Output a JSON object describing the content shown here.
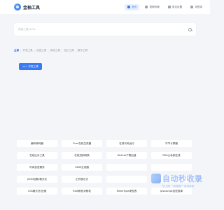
{
  "header": {
    "logo_text": "金柚工具",
    "nav": [
      {
        "label": "首页",
        "active": true
      },
      {
        "label": "视频有哪",
        "active": false
      },
      {
        "label": "常见设置",
        "active": false
      },
      {
        "label": "未登录",
        "active": false
      }
    ]
  },
  "search": {
    "placeholder": "搜索工具/Yo/Yo"
  },
  "tabs": [
    {
      "label": "全部",
      "active": true
    },
    {
      "label": "开发工具",
      "active": false
    },
    {
      "label": "加密工具",
      "active": false
    },
    {
      "label": "实用工具",
      "active": false
    },
    {
      "label": "站长工具",
      "active": false
    },
    {
      "label": "娱乐工具",
      "active": false
    }
  ],
  "section": {
    "label": "开发工具"
  },
  "tools": [
    "编码转码器",
    "Cron在线生成器",
    "在线代码运行",
    "字节计算器",
    "在线比对工具",
    "在线进制转换",
    "GitHub下载加速",
    "RSA公私钥生成",
    "时间加密服务",
    "UUID生成器",
    "",
    "",
    "JSON加载/格式化",
    "正则表达式",
    "",
    "",
    "CSS格式化/压缩",
    "RGB颜色对照表",
    "MimeType类型表",
    "Javascript加密混淆"
  ],
  "watermark": {
    "title": "自动秒收录",
    "subtitle": "快上推一·快速推广·自动收录"
  },
  "colors": {
    "accent": "#3a7af2",
    "background": "#f3f5f9"
  }
}
